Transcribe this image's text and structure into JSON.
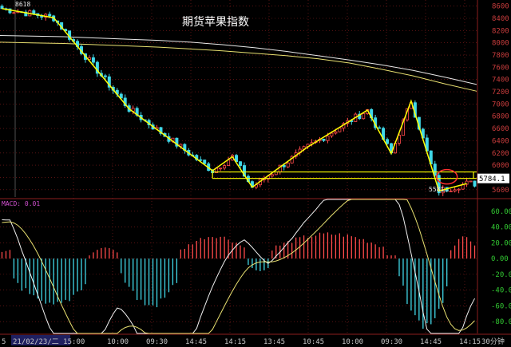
{
  "colors": {
    "background": "#000000",
    "grid": "#8c1e1e",
    "up": "#ff4a4a",
    "down": "#40d8e8",
    "ma_white": "#e8e8e8",
    "ma_yellow": "#e8e070",
    "pattern": "#ffff00",
    "marker": "#ff3030",
    "macd_dif": "#f0f0f0",
    "macd_dea": "#e8e070"
  },
  "chart_data": [
    {
      "type": "candlestick",
      "title": "期货苹果指数",
      "ylim": [
        5480,
        8700
      ],
      "y_ticks": [
        8600,
        8500,
        8400,
        8300,
        8200,
        8100,
        8000,
        7900,
        7800,
        7700,
        7600,
        7500,
        7400,
        7300,
        7200,
        7100,
        7000,
        6900,
        6800,
        6700,
        6600,
        6500,
        6400,
        6300,
        6200,
        6100,
        6000,
        5900,
        5800,
        5700,
        5600,
        5500
      ],
      "y_tick_labels": [
        "8600",
        "8500",
        "8400",
        "8300",
        "8200",
        "8100",
        "8000",
        "7900",
        "7800",
        "7700",
        "7600",
        "7500",
        "7400",
        "7300",
        "7200",
        "7100",
        "7000",
        "6900",
        "6800",
        "6700",
        "6600",
        "6500",
        "6400",
        "6300",
        "6200",
        "6100",
        "6000",
        "5900",
        "5800",
        "5700",
        "5600",
        "5500"
      ],
      "high_label": "8618",
      "low_label": "5581",
      "current_price_label": "5784.1",
      "current_price": 5784.1,
      "support_level": 5784.1,
      "resistance_level": 5890,
      "zigzag": [
        {
          "i": 0,
          "v": 8560
        },
        {
          "i": 13,
          "v": 8410
        },
        {
          "i": 32,
          "v": 6920
        },
        {
          "i": 53,
          "v": 5910
        },
        {
          "i": 58,
          "v": 6140
        },
        {
          "i": 63,
          "v": 5640
        },
        {
          "i": 77,
          "v": 6300
        },
        {
          "i": 92,
          "v": 6900
        },
        {
          "i": 98,
          "v": 6190
        },
        {
          "i": 103,
          "v": 7050
        },
        {
          "i": 110,
          "v": 5581
        },
        {
          "i": 117,
          "v": 5700
        }
      ],
      "candles_note": "approximate OHLC path reconstructed from visual",
      "ma_long": [
        8120,
        8110,
        8100,
        8080,
        8060,
        8040,
        8010,
        7970,
        7920,
        7860,
        7790,
        7720,
        7640,
        7550,
        7440,
        7320
      ],
      "ma_mid": [
        8010,
        8000,
        7990,
        7970,
        7950,
        7930,
        7900,
        7870,
        7830,
        7790,
        7740,
        7670,
        7570,
        7460,
        7330,
        7210
      ]
    },
    {
      "type": "bar",
      "title": "MACD: 0.01",
      "ylim": [
        -95,
        75
      ],
      "y_ticks": [
        60,
        40,
        20,
        0,
        -20,
        -40,
        -60,
        -80
      ],
      "y_tick_labels": [
        "60.00",
        "40.00",
        "20.00",
        "0.00",
        "-20.00",
        "-40.00",
        "-60.00",
        "-80.00"
      ],
      "macd_value_label": "MACD: 0.01"
    }
  ],
  "x_axis": {
    "labels": [
      "21/02/23/二 15:00",
      "10:00",
      "09:30",
      "14:45",
      "14:15",
      "13:45",
      "10:45",
      "10:00",
      "09:30",
      "14:45",
      "14:15"
    ],
    "left_edge_label": "5",
    "period_label": "30分钟"
  }
}
